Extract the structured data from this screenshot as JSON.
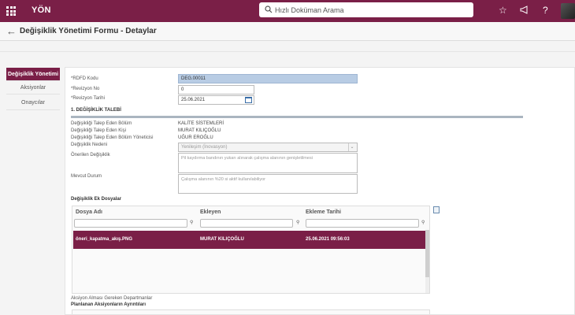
{
  "app": {
    "logo": "YÖN"
  },
  "search": {
    "placeholder": "Hızlı Doküman Arama"
  },
  "topbar_icons": [
    "star-icon",
    "megaphone-icon",
    "help-icon"
  ],
  "page": {
    "title": "Değişiklik Yönetimi Formu - Detaylar"
  },
  "nav": {
    "items": [
      {
        "label": "Değişiklik Yönetimi",
        "active": true
      },
      {
        "label": "Aksiyonlar",
        "active": false
      },
      {
        "label": "Onaycılar",
        "active": false
      }
    ]
  },
  "form": {
    "rdfd_label": "*RDFD Kodu",
    "rdfd_value": "DEG.00011",
    "rev_no_label": "*Revizyon No",
    "rev_no_value": "0",
    "rev_date_label": "*Revizyon Tarihi",
    "rev_date_value": "25.06.2021",
    "section1_title": "1. DEĞİŞİKLİK TALEBİ",
    "dept_label": "Değişikliği Talep Eden Bölüm",
    "dept_value": "KALİTE SİSTEMLERİ",
    "person_label": "Değişikliği Talep Eden Kişi",
    "person_value": "MURAT KILIÇOĞLU",
    "manager_label": "Değişikliği Talep Eden Bölüm Yöneticisi",
    "manager_value": "UĞUR EROĞLU",
    "reason_label": "Değişiklik Nedeni",
    "reason_value": "Yenileşim (İnovasyon)",
    "proposed_label": "Önerilen Değişiklik",
    "proposed_value": "Pil kaydırma bandının yukarı alınarak çalışma alanının genişletilmesi",
    "current_label": "Mevcut Durum",
    "current_value": "Çalışma alanının %20 si aktif kullanılabiliyor",
    "attachments_title": "Değişiklik Ek Dosyalar",
    "depts_label": "Aksiyon Alması Gereken Departmanlar",
    "actions_title": "Planlanan Aksiyonların Ayrıntıları"
  },
  "table": {
    "columns": [
      "Dosya Adı",
      "Ekleyen",
      "Ekleme Tarihi"
    ],
    "rows": [
      {
        "file": "öneri_kapatma_akış.PNG",
        "added_by": "MURAT KILIÇOĞLU",
        "date": "25.06.2021 09:56:03"
      }
    ]
  },
  "colors": {
    "brand": "#7a1f47",
    "highlight_field": "#b8cce4"
  }
}
